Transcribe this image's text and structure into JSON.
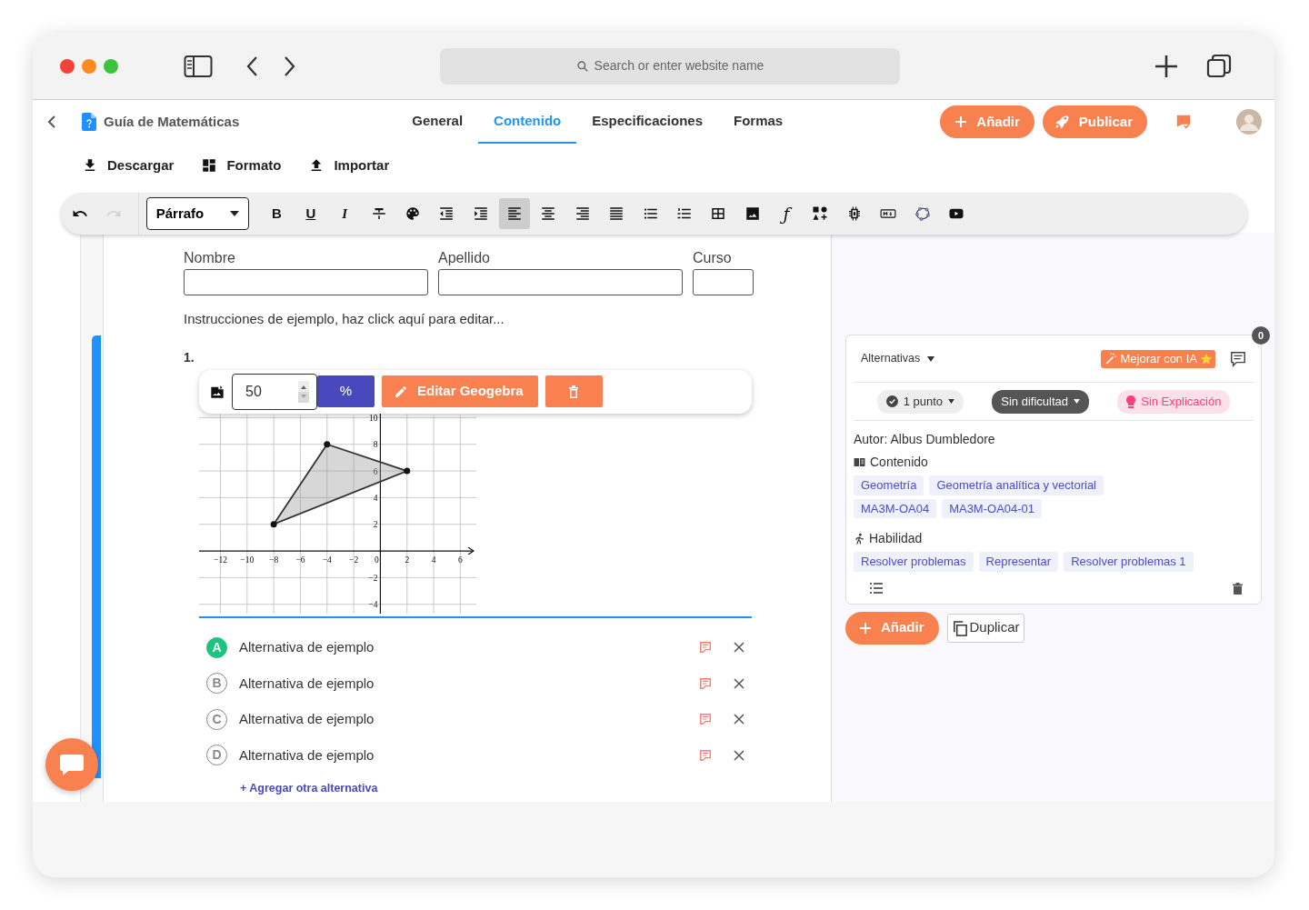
{
  "browser": {
    "address_placeholder": "Search or enter website name"
  },
  "header": {
    "title": "Guía de Matemáticas",
    "tabs": [
      {
        "label": "General",
        "selected": false
      },
      {
        "label": "Contenido",
        "selected": true
      },
      {
        "label": "Especificaciones",
        "selected": false
      },
      {
        "label": "Formas",
        "selected": false
      }
    ],
    "add_button": "Añadir",
    "publish_button": "Publicar"
  },
  "actions": [
    {
      "kind": "download",
      "label": "Descargar"
    },
    {
      "kind": "format",
      "label": "Formato"
    },
    {
      "kind": "upload",
      "label": "Importar"
    }
  ],
  "toolbar": {
    "block_style": "Párrafo",
    "buttons": [
      {
        "kind": "undo",
        "selected": false,
        "disabled": false
      },
      {
        "kind": "redo",
        "selected": false,
        "disabled": true
      },
      {
        "kind": "group"
      },
      {
        "kind": "bold",
        "label": "B",
        "selected": false,
        "disabled": false
      },
      {
        "kind": "underline",
        "label": "U",
        "selected": false,
        "disabled": false
      },
      {
        "kind": "italic",
        "label": "I",
        "selected": false,
        "disabled": false
      },
      {
        "kind": "strike",
        "selected": false,
        "disabled": false
      },
      {
        "kind": "palette",
        "selected": false,
        "disabled": false
      },
      {
        "kind": "outdent",
        "selected": false,
        "disabled": false
      },
      {
        "kind": "indent",
        "selected": false,
        "disabled": false
      },
      {
        "kind": "alignleft",
        "selected": true,
        "disabled": false
      },
      {
        "kind": "aligncenter",
        "selected": false,
        "disabled": false
      },
      {
        "kind": "alignright",
        "selected": false,
        "disabled": false
      },
      {
        "kind": "justify",
        "selected": false,
        "disabled": false
      },
      {
        "kind": "bullets",
        "selected": false,
        "disabled": false
      },
      {
        "kind": "numbers",
        "selected": false,
        "disabled": false
      },
      {
        "kind": "table",
        "selected": false,
        "disabled": false
      },
      {
        "kind": "image",
        "selected": false,
        "disabled": false
      },
      {
        "kind": "formula",
        "label": "ƒ",
        "selected": false,
        "disabled": false
      },
      {
        "kind": "shapes",
        "selected": false,
        "disabled": false
      },
      {
        "kind": "chip",
        "selected": false,
        "disabled": false
      },
      {
        "kind": "markdown",
        "selected": false,
        "disabled": false
      },
      {
        "kind": "geogebra",
        "selected": false,
        "disabled": false
      },
      {
        "kind": "video",
        "selected": false,
        "disabled": false
      }
    ]
  },
  "form": {
    "fields": [
      {
        "label": "Nombre",
        "kind": "wide"
      },
      {
        "label": "Apellido",
        "kind": "wide"
      },
      {
        "label": "Curso",
        "kind": "narrow"
      }
    ],
    "instructions": "Instrucciones de ejemplo, haz click aquí para editar..."
  },
  "question": {
    "number": "1.",
    "image_toolbar": {
      "size": "50",
      "unit": "%",
      "edit_label": "Editar Geogebra"
    },
    "chart_data": {
      "type": "area",
      "grid": true,
      "x": [
        -8,
        -4,
        2,
        -8
      ],
      "series": [
        {
          "values": [
            2,
            8,
            6,
            2
          ]
        }
      ],
      "xlim": [
        -13.6,
        7.2
      ],
      "ylim": [
        -4.7,
        10.3
      ],
      "xticks": [
        {
          "value": -12,
          "label": "−12"
        },
        {
          "value": -10,
          "label": "−10"
        },
        {
          "value": -8,
          "label": "−8"
        },
        {
          "value": -6,
          "label": "−6"
        },
        {
          "value": -4,
          "label": "−4"
        },
        {
          "value": -2,
          "label": "−2"
        },
        0,
        2,
        4,
        6
      ],
      "yticks": [
        {
          "value": -4,
          "label": "−4"
        },
        {
          "value": -2,
          "label": "−2"
        },
        2,
        4,
        6,
        8,
        10
      ]
    },
    "alternatives": [
      {
        "letter": "A",
        "text": "Alternativa de ejemplo",
        "selected": true
      },
      {
        "letter": "B",
        "text": "Alternativa de ejemplo",
        "selected": false
      },
      {
        "letter": "C",
        "text": "Alternativa de ejemplo",
        "selected": false
      },
      {
        "letter": "D",
        "text": "Alternativa de ejemplo",
        "selected": false
      }
    ],
    "add_link": "+ Agregar otra alternativa"
  },
  "panel": {
    "type_label": "Alternativas",
    "ai_button": "Mejorar con IA",
    "comment_count": "0",
    "points": "1 punto",
    "difficulty": "Sin dificultad",
    "explanation": "Sin Explicación",
    "author": "Autor: Albus Dumbledore",
    "content_heading": "Contenido",
    "content_tags": [
      "Geometría",
      "Geometría analítica y vectorial",
      "MA3M-OA04",
      "MA3M-OA04-01"
    ],
    "skills_heading": "Habilidad",
    "skill_tags": [
      "Resolver problemas",
      "Representar",
      "Resolver problemas 1"
    ],
    "add_button": "Añadir",
    "duplicate_button": "Duplicar"
  }
}
